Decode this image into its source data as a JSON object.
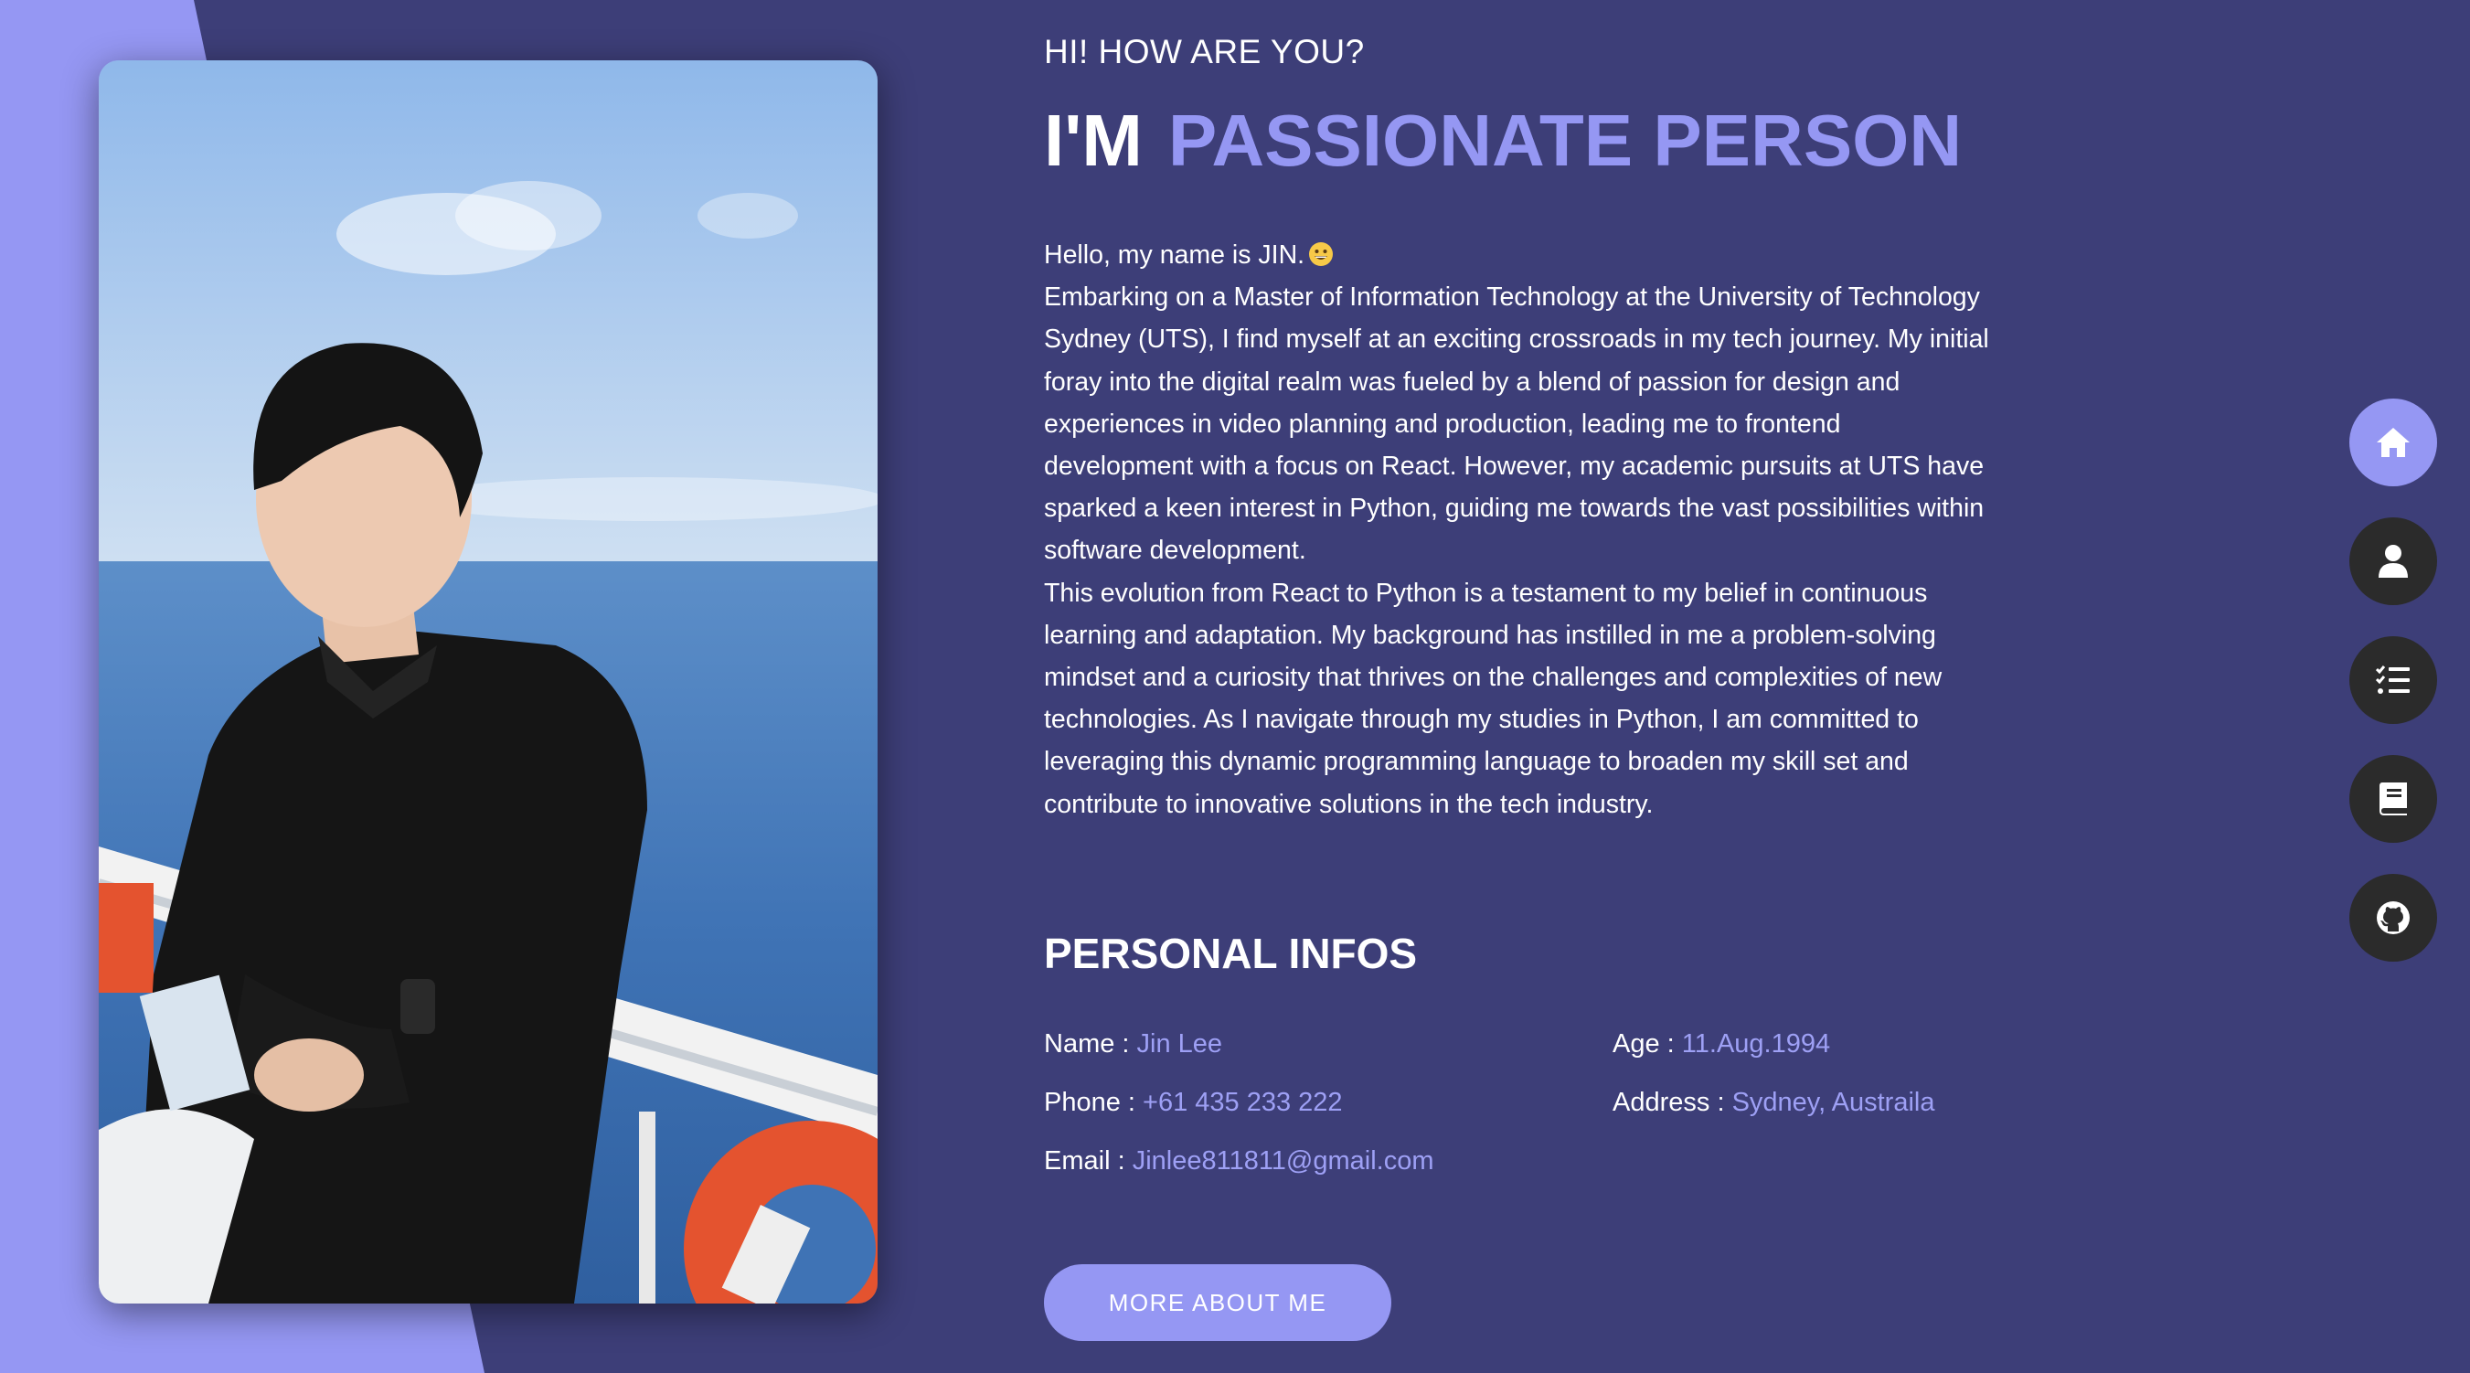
{
  "hero": {
    "greeting": "HI! HOW ARE YOU?",
    "headline_prefix": "I'M",
    "headline_accent": "PASSIONATE PERSON"
  },
  "bio": {
    "line1": "Hello, my name is JIN.",
    "paragraph1": "Embarking on a Master of Information Technology at the University of Technology Sydney (UTS), I find myself at an exciting crossroads in my tech journey. My initial foray into the digital realm was fueled by a blend of passion for design and experiences in video planning and production, leading me to frontend development with a focus on React. However, my academic pursuits at UTS have sparked a keen interest in Python, guiding me towards the vast possibilities within software development.",
    "paragraph2": "This evolution from React to Python is a testament to my belief in continuous learning and adaptation. My background has instilled in me a problem-solving mindset and a curiosity that thrives on the challenges and complexities of new technologies. As I navigate through my studies in Python, I am committed to leveraging this dynamic programming language to broaden my skill set and contribute to innovative solutions in the tech industry."
  },
  "personal_infos": {
    "title": "PERSONAL INFOS",
    "name_label": "Name : ",
    "name_value": "Jin Lee",
    "age_label": "Age : ",
    "age_value": "11.Aug.1994",
    "phone_label": "Phone : ",
    "phone_value": "+61 435 233 222",
    "address_label": "Address : ",
    "address_value": "Sydney, Austraila",
    "email_label": "Email : ",
    "email_value": "Jinlee811811@gmail.com"
  },
  "cta": {
    "more_label": "MORE ABOUT ME"
  },
  "side_nav": {
    "items": [
      {
        "icon": "home-icon",
        "active": true
      },
      {
        "icon": "user-icon",
        "active": false
      },
      {
        "icon": "list-check-icon",
        "active": false
      },
      {
        "icon": "book-icon",
        "active": false
      },
      {
        "icon": "github-icon",
        "active": false
      }
    ]
  },
  "colors": {
    "background": "#3d3e78",
    "accent": "#9597f3",
    "nav_dark": "#2b2b2b",
    "text": "#ffffff"
  }
}
